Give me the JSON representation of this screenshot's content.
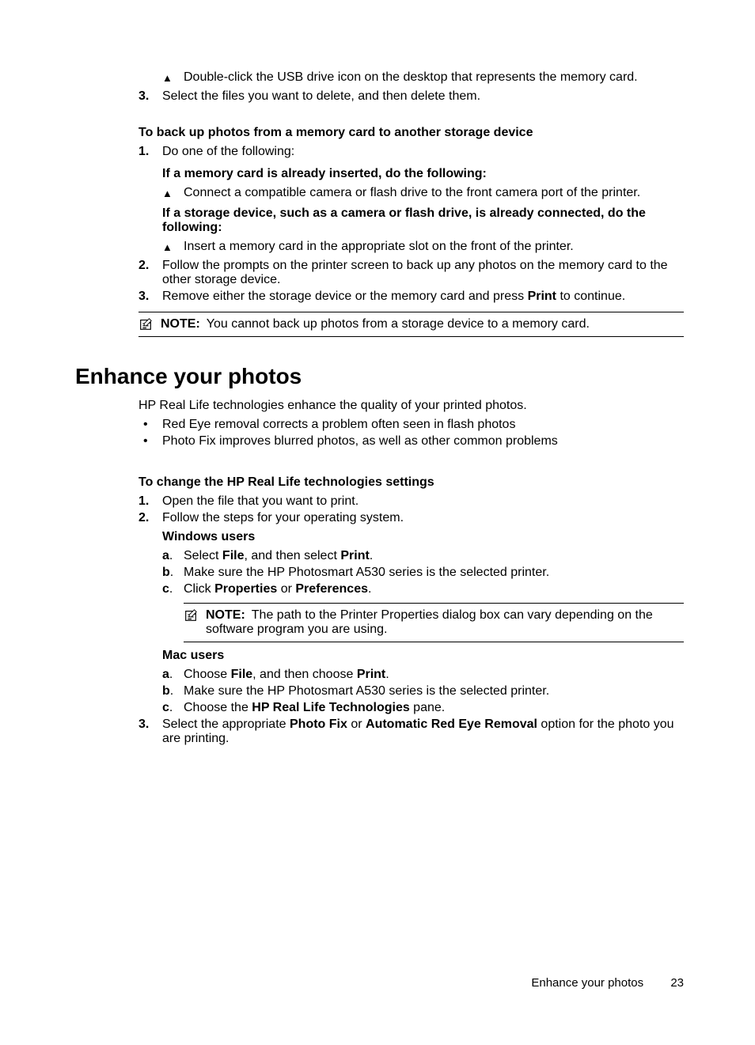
{
  "section1": {
    "tri1": "Double-click the USB drive icon on the desktop that represents the memory card.",
    "step3": "Select the files you want to delete, and then delete them."
  },
  "backup": {
    "heading": "To back up photos from a memory card to another storage device",
    "step1_intro": "Do one of the following:",
    "case1_heading": "If a memory card is already inserted, do the following:",
    "case1_action": "Connect a compatible camera or flash drive to the front camera port of the printer.",
    "case2_heading": "If a storage device, such as a camera or flash drive, is already connected, do the following:",
    "case2_action": "Insert a memory card in the appropriate slot on the front of the printer.",
    "step2": "Follow the prompts on the printer screen to back up any photos on the memory card to the other storage device.",
    "step3_pre": "Remove either the storage device or the memory card and press ",
    "step3_bold": "Print",
    "step3_post": " to continue.",
    "note_label": "NOTE:",
    "note_text": "You cannot back up photos from a storage device to a memory card."
  },
  "enhance": {
    "title": "Enhance your photos",
    "intro": "HP Real Life technologies enhance the quality of your printed photos.",
    "bullet1": "Red Eye removal corrects a problem often seen in flash photos",
    "bullet2": "Photo Fix improves blurred photos, as well as other common problems",
    "change_heading": "To change the HP Real Life technologies settings",
    "step1": "Open the file that you want to print.",
    "step2": "Follow the steps for your operating system.",
    "win_heading": "Windows users",
    "win_a_pre": "Select ",
    "win_a_b1": "File",
    "win_a_mid": ", and then select ",
    "win_a_b2": "Print",
    "win_a_post": ".",
    "win_b": "Make sure the HP Photosmart A530 series is the selected printer.",
    "win_c_pre": "Click ",
    "win_c_b1": "Properties",
    "win_c_mid": " or ",
    "win_c_b2": "Preferences",
    "win_c_post": ".",
    "win_note_label": "NOTE:",
    "win_note_text": "The path to the Printer Properties dialog box can vary depending on the software program you are using.",
    "mac_heading": "Mac users",
    "mac_a_pre": "Choose ",
    "mac_a_b1": "File",
    "mac_a_mid": ", and then choose ",
    "mac_a_b2": "Print",
    "mac_a_post": ".",
    "mac_b": "Make sure the HP Photosmart A530 series is the selected printer.",
    "mac_c_pre": "Choose the ",
    "mac_c_b1": "HP Real Life Technologies",
    "mac_c_post": " pane.",
    "step3_pre": "Select the appropriate ",
    "step3_b1": "Photo Fix",
    "step3_mid": " or ",
    "step3_b2": "Automatic Red Eye Removal",
    "step3_post": " option for the photo you are printing."
  },
  "footer": {
    "section": "Enhance your photos",
    "page": "23"
  },
  "labels": {
    "n1": "1.",
    "n2": "2.",
    "n3": "3.",
    "la": "a",
    "lb": "b",
    "lc": "c",
    "dot": ".",
    "triangle": "▲",
    "bullet": "•"
  }
}
